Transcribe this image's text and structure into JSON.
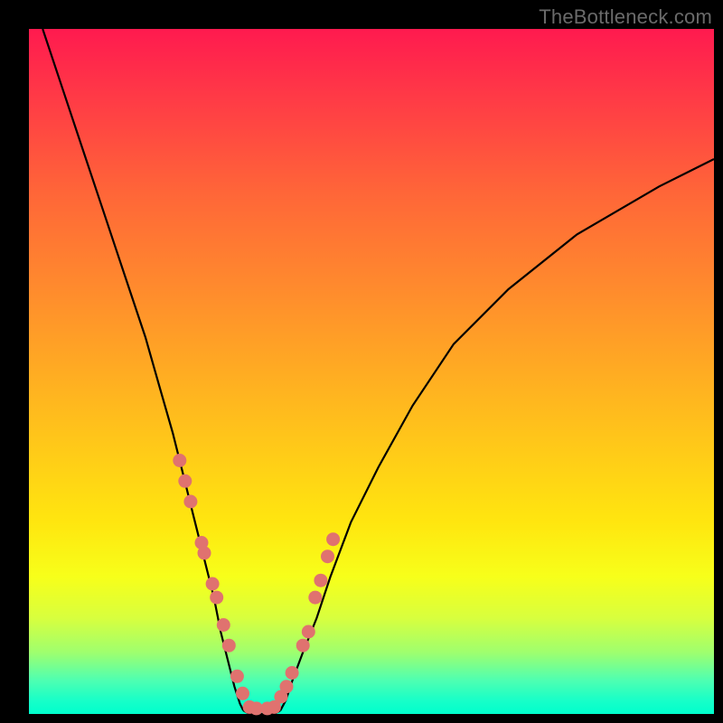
{
  "watermark": "TheBottleneck.com",
  "chart_data": {
    "type": "line",
    "title": "",
    "xlabel": "",
    "ylabel": "",
    "xlim": [
      0,
      100
    ],
    "ylim": [
      0,
      100
    ],
    "grid": false,
    "legend": false,
    "series": [
      {
        "name": "curve-left",
        "x": [
          2,
          5,
          8,
          11,
          14,
          17,
          19,
          21,
          22.5,
          24,
          25.5,
          27,
          28,
          29,
          30,
          30.8,
          31.3
        ],
        "y": [
          100,
          91,
          82,
          73,
          64,
          55,
          48,
          41,
          35,
          29,
          23,
          17,
          12,
          8,
          4,
          1.5,
          0.5
        ]
      },
      {
        "name": "curve-floor",
        "x": [
          31.3,
          32,
          33,
          34,
          35,
          36,
          36.7
        ],
        "y": [
          0.5,
          0.1,
          0,
          0,
          0,
          0.1,
          0.5
        ]
      },
      {
        "name": "curve-right",
        "x": [
          36.7,
          37.5,
          38.5,
          40,
          42,
          44,
          47,
          51,
          56,
          62,
          70,
          80,
          92,
          100
        ],
        "y": [
          0.5,
          2,
          5,
          9,
          14,
          20,
          28,
          36,
          45,
          54,
          62,
          70,
          77,
          81
        ]
      }
    ],
    "scatter": [
      {
        "name": "dots-left",
        "x": [
          22.0,
          22.8,
          23.6,
          25.2,
          25.6,
          26.8,
          27.4,
          28.4,
          29.2,
          30.4,
          31.2,
          32.2,
          33.2,
          34.8,
          35.8
        ],
        "y": [
          37,
          34,
          31,
          25,
          23.5,
          19,
          17,
          13,
          10,
          5.5,
          3,
          1,
          0.8,
          0.8,
          1
        ]
      },
      {
        "name": "dots-right",
        "x": [
          36.8,
          37.6,
          38.4,
          40.0,
          40.8,
          41.8,
          42.6,
          43.6,
          44.4
        ],
        "y": [
          2.5,
          4,
          6,
          10,
          12,
          17,
          19.5,
          23,
          25.5
        ]
      }
    ],
    "background_gradient": {
      "top": "#ff1a4f",
      "bottom": "#00ffcd"
    },
    "dot_color": "#e0726f",
    "curve_color": "#000000"
  }
}
